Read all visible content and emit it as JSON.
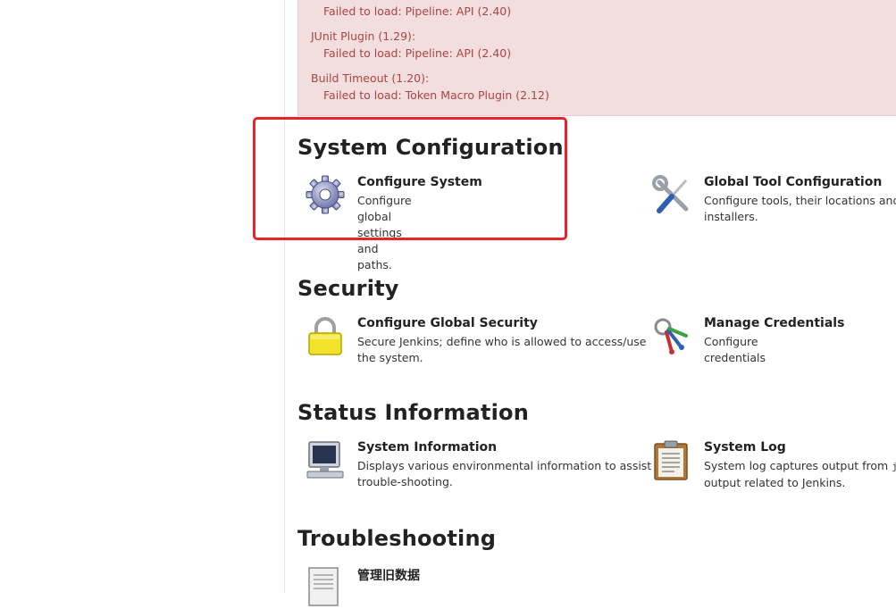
{
  "alerts": {
    "line_0": "Failed to load: Pipeline: API (2.40)",
    "plugin_1": "JUnit Plugin (1.29):",
    "line_1": "Failed to load: Pipeline: API (2.40)",
    "plugin_2": "Build Timeout (1.20):",
    "line_2": "Failed to load: Token Macro Plugin (2.12)"
  },
  "sections": {
    "system_configuration": {
      "title": "System Configuration",
      "items": [
        {
          "title": "Configure System",
          "desc": "Configure global settings and paths.",
          "icon": "gear-icon"
        },
        {
          "title": "Global Tool Configuration",
          "desc_1": "Configure tools, their locations and au",
          "desc_2": "installers.",
          "icon": "tools-icon"
        }
      ]
    },
    "security": {
      "title": "Security",
      "items": [
        {
          "title": "Configure Global Security",
          "desc_1": "Secure Jenkins; define who is allowed to access/use",
          "desc_2": "the system.",
          "icon": "lock-icon"
        },
        {
          "title": "Manage Credentials",
          "desc": "Configure credentials",
          "icon": "keys-icon"
        }
      ]
    },
    "status_information": {
      "title": "Status Information",
      "items": [
        {
          "title": "System Information",
          "desc_1": "Displays various environmental information to assist",
          "desc_2": "trouble-shooting.",
          "icon": "computer-icon"
        },
        {
          "title": "System Log",
          "desc_1a": "System log captures output from ",
          "desc_1b": "jav",
          "desc_2": "output related to Jenkins.",
          "icon": "clipboard-icon"
        }
      ]
    },
    "troubleshooting": {
      "title": "Troubleshooting",
      "items": [
        {
          "title": "管理旧数据",
          "icon": "document-icon"
        }
      ]
    }
  },
  "colors": {
    "alert_bg": "#f2dede",
    "alert_text": "#a94442",
    "highlight": "#e8232a"
  }
}
